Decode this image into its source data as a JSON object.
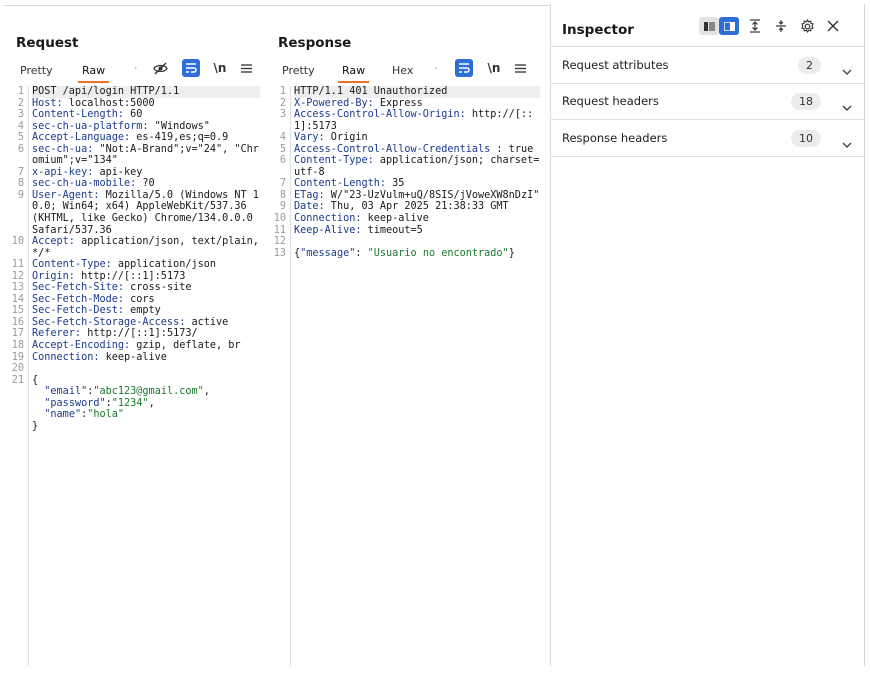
{
  "request": {
    "title": "Request",
    "tabs": [
      "Pretty",
      "Raw"
    ],
    "lines": [
      {
        "n": "1",
        "parts": [
          [
            "plain",
            "POST /api/login HTTP/1.1"
          ]
        ]
      },
      {
        "n": "2",
        "parts": [
          [
            "key",
            "Host:"
          ],
          [
            "plain",
            " localhost:5000"
          ]
        ]
      },
      {
        "n": "3",
        "parts": [
          [
            "key",
            "Content-Length:"
          ],
          [
            "plain",
            " 60"
          ]
        ]
      },
      {
        "n": "4",
        "parts": [
          [
            "key",
            "sec-ch-ua-platform:"
          ],
          [
            "plain",
            " \"Windows\""
          ]
        ]
      },
      {
        "n": "5",
        "parts": [
          [
            "key",
            "Accept-Language:"
          ],
          [
            "plain",
            " es-419,es;q=0.9"
          ]
        ]
      },
      {
        "n": "6",
        "parts": [
          [
            "key",
            "sec-ch-ua:"
          ],
          [
            "plain",
            " \"Not:A-Brand\";v=\"24\", \"Chromium\";v=\"134\""
          ]
        ]
      },
      {
        "n": "7",
        "parts": [
          [
            "key",
            "x-api-key:"
          ],
          [
            "plain",
            " api-key"
          ]
        ]
      },
      {
        "n": "8",
        "parts": [
          [
            "key",
            "sec-ch-ua-mobile:"
          ],
          [
            "plain",
            " ?0"
          ]
        ]
      },
      {
        "n": "9",
        "parts": [
          [
            "key",
            "User-Agent:"
          ],
          [
            "plain",
            " Mozilla/5.0 (Windows NT 10.0; Win64; x64) AppleWebKit/537.36 (KHTML, like Gecko) Chrome/134.0.0.0 Safari/537.36"
          ]
        ]
      },
      {
        "n": "10",
        "parts": [
          [
            "key",
            "Accept:"
          ],
          [
            "plain",
            " application/json, text/plain, */*"
          ]
        ]
      },
      {
        "n": "11",
        "parts": [
          [
            "key",
            "Content-Type:"
          ],
          [
            "plain",
            " application/json"
          ]
        ]
      },
      {
        "n": "12",
        "parts": [
          [
            "key",
            "Origin:"
          ],
          [
            "plain",
            " http://[::1]:5173"
          ]
        ]
      },
      {
        "n": "13",
        "parts": [
          [
            "key",
            "Sec-Fetch-Site:"
          ],
          [
            "plain",
            " cross-site"
          ]
        ]
      },
      {
        "n": "14",
        "parts": [
          [
            "key",
            "Sec-Fetch-Mode:"
          ],
          [
            "plain",
            " cors"
          ]
        ]
      },
      {
        "n": "15",
        "parts": [
          [
            "key",
            "Sec-Fetch-Dest:"
          ],
          [
            "plain",
            " empty"
          ]
        ]
      },
      {
        "n": "16",
        "parts": [
          [
            "key",
            "Sec-Fetch-Storage-Access:"
          ],
          [
            "plain",
            " active"
          ]
        ]
      },
      {
        "n": "17",
        "parts": [
          [
            "key",
            "Referer:"
          ],
          [
            "plain",
            " http://[::1]:5173/"
          ]
        ]
      },
      {
        "n": "18",
        "parts": [
          [
            "key",
            "Accept-Encoding:"
          ],
          [
            "plain",
            " gzip, deflate, br"
          ]
        ]
      },
      {
        "n": "19",
        "parts": [
          [
            "key",
            "Connection:"
          ],
          [
            "plain",
            " keep-alive"
          ]
        ]
      },
      {
        "n": "20",
        "parts": [
          [
            "plain",
            ""
          ]
        ]
      },
      {
        "n": "21",
        "parts": [
          [
            "plain",
            "{"
          ]
        ]
      },
      {
        "n": "",
        "parts": [
          [
            "plain",
            "  "
          ],
          [
            "jkey",
            "\"email\""
          ],
          [
            "plain",
            ":"
          ],
          [
            "str",
            "\"abc123@gmail.com\""
          ],
          [
            "plain",
            ","
          ]
        ]
      },
      {
        "n": "",
        "parts": [
          [
            "plain",
            "  "
          ],
          [
            "jkey",
            "\"password\""
          ],
          [
            "plain",
            ":"
          ],
          [
            "str",
            "\"1234\""
          ],
          [
            "plain",
            ","
          ]
        ]
      },
      {
        "n": "",
        "parts": [
          [
            "plain",
            "  "
          ],
          [
            "jkey",
            "\"name\""
          ],
          [
            "plain",
            ":"
          ],
          [
            "str",
            "\"hola\""
          ]
        ]
      },
      {
        "n": "",
        "parts": [
          [
            "plain",
            "}"
          ]
        ]
      }
    ]
  },
  "response": {
    "title": "Response",
    "tabs": [
      "Pretty",
      "Raw",
      "Hex"
    ],
    "lines": [
      {
        "n": "1",
        "parts": [
          [
            "plain",
            "HTTP/1.1 401 Unauthorized"
          ]
        ]
      },
      {
        "n": "2",
        "parts": [
          [
            "key",
            "X-Powered-By:"
          ],
          [
            "plain",
            " Express"
          ]
        ]
      },
      {
        "n": "3",
        "parts": [
          [
            "key",
            "Access-Control-Allow-Origin:"
          ],
          [
            "plain",
            " http://[::1]:5173"
          ]
        ]
      },
      {
        "n": "4",
        "parts": [
          [
            "key",
            "Vary:"
          ],
          [
            "plain",
            " Origin"
          ]
        ]
      },
      {
        "n": "5",
        "parts": [
          [
            "key",
            "Access-Control-Allow-Credentials"
          ],
          [
            "plain",
            " : true"
          ]
        ]
      },
      {
        "n": "6",
        "parts": [
          [
            "key",
            "Content-Type:"
          ],
          [
            "plain",
            " application/json; charset=utf-8"
          ]
        ]
      },
      {
        "n": "7",
        "parts": [
          [
            "key",
            "Content-Length:"
          ],
          [
            "plain",
            " 35"
          ]
        ]
      },
      {
        "n": "8",
        "parts": [
          [
            "key",
            "ETag:"
          ],
          [
            "plain",
            " W/\"23-UzVulm+uQ/8SIS/jVoweXW8nDzI\""
          ]
        ]
      },
      {
        "n": "9",
        "parts": [
          [
            "key",
            "Date:"
          ],
          [
            "plain",
            " Thu, 03 Apr 2025 21:38:33 GMT"
          ]
        ]
      },
      {
        "n": "10",
        "parts": [
          [
            "key",
            "Connection:"
          ],
          [
            "plain",
            " keep-alive"
          ]
        ]
      },
      {
        "n": "11",
        "parts": [
          [
            "key",
            "Keep-Alive:"
          ],
          [
            "plain",
            " timeout=5"
          ]
        ]
      },
      {
        "n": "12",
        "parts": [
          [
            "plain",
            ""
          ]
        ]
      },
      {
        "n": "13",
        "parts": [
          [
            "plain",
            "{"
          ],
          [
            "jkey",
            "\"message\""
          ],
          [
            "plain",
            ": "
          ],
          [
            "str",
            "\"Usuario no encontrado\""
          ],
          [
            "plain",
            "}"
          ]
        ]
      }
    ]
  },
  "inspector": {
    "title": "Inspector",
    "sections": [
      {
        "label": "Request attributes",
        "count": "2"
      },
      {
        "label": "Request headers",
        "count": "18"
      },
      {
        "label": "Response headers",
        "count": "10"
      }
    ]
  },
  "icons": {
    "hide": "eye-off-icon",
    "wrap": "wrap-lines-icon",
    "newline": "\\n",
    "menu": "menu-icon",
    "settings": "gear-icon",
    "close": "close-icon"
  },
  "colors": {
    "accent": "#2d6fd6",
    "tab_underline": "#e8712d",
    "header_key": "#1b3a8f",
    "json_string": "#1a7a2e"
  }
}
